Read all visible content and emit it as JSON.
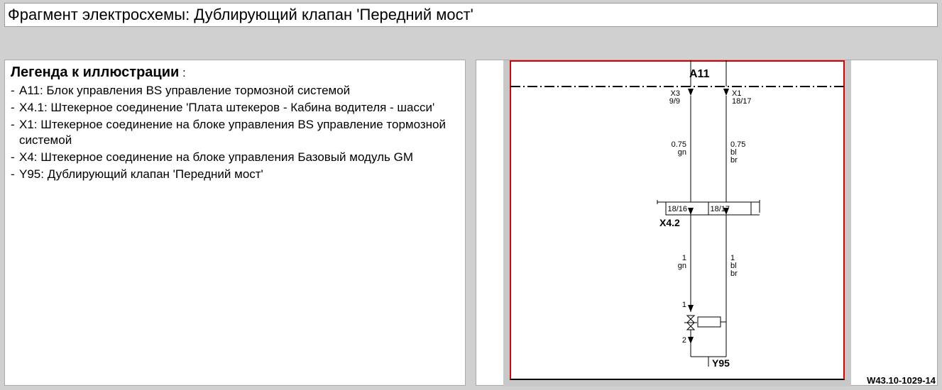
{
  "title": "Фрагмент электросхемы: Дублирующий клапан 'Передний мост'",
  "legend": {
    "heading": "Легенда к иллюстрации",
    "colon": " :",
    "items": [
      "A11: Блок управления BS управление тормозной системой",
      "X4.1: Штекерное соединение 'Плата штекеров - Кабина водителя - шасси'",
      "X1: Штекерное соединение на блоке управления BS управление тормозной системой",
      "X4: Штекерное соединение на блоке управления Базовый модуль GM",
      "Y95: Дублирующий клапан 'Передний мост'"
    ]
  },
  "diagram": {
    "drawing_no": "W43.10-1029-14",
    "a11": "A11",
    "x4_2": "X4.2",
    "y95": "Y95",
    "top_left_conn": {
      "name": "X3",
      "pins": "9/9"
    },
    "top_right_conn": {
      "name": "X1",
      "pins": "18/17"
    },
    "wire_left_top": {
      "size": "0.75",
      "color": "gn"
    },
    "wire_right_top": {
      "size": "0.75",
      "color1": "bl",
      "color2": "br"
    },
    "conn_box": {
      "left": "18/16",
      "right": "18/17"
    },
    "wire_left_bot": {
      "size": "1",
      "color": "gn"
    },
    "wire_right_bot": {
      "size": "1",
      "color1": "bl",
      "color2": "br"
    },
    "pin1": "1",
    "pin2": "2"
  }
}
